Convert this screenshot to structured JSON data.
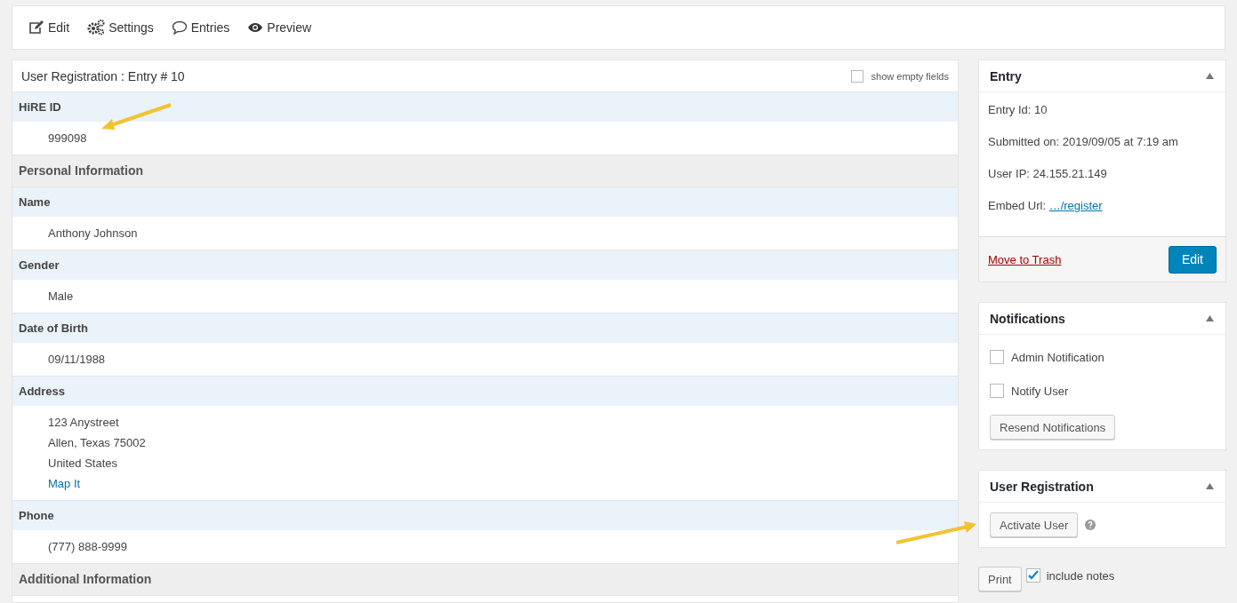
{
  "toolbar": [
    {
      "label": "Edit"
    },
    {
      "label": "Settings"
    },
    {
      "label": "Entries"
    },
    {
      "label": "Preview"
    }
  ],
  "entry_panel": {
    "title": "User Registration : Entry # 10",
    "show_empty_fields": {
      "label": "show empty fields",
      "checked": false
    },
    "rows": [
      {
        "kind": "field",
        "label": "HiRE ID",
        "values": [
          "999098"
        ]
      },
      {
        "kind": "section",
        "label": "Personal Information"
      },
      {
        "kind": "field",
        "label": "Name",
        "values": [
          "Anthony Johnson"
        ]
      },
      {
        "kind": "field",
        "label": "Gender",
        "values": [
          "Male"
        ]
      },
      {
        "kind": "field",
        "label": "Date of Birth",
        "values": [
          "09/11/1988"
        ]
      },
      {
        "kind": "field",
        "label": "Address",
        "values": [
          "123 Anystreet",
          "Allen, Texas 75002",
          "United States"
        ],
        "link": "Map It"
      },
      {
        "kind": "field",
        "label": "Phone",
        "values": [
          "(777) 888-9999"
        ]
      },
      {
        "kind": "section",
        "label": "Additional Information"
      }
    ]
  },
  "entry_box": {
    "title": "Entry",
    "lines": [
      {
        "text": "Entry Id: 10"
      },
      {
        "text": "Submitted on: 2019/09/05 at 7:19 am"
      },
      {
        "text": "User IP: 24.155.21.149"
      },
      {
        "text": "Embed Url:",
        "link": "…/register"
      }
    ],
    "trash": "Move to Trash",
    "edit": "Edit"
  },
  "notifications_box": {
    "title": "Notifications",
    "options": [
      {
        "label": "Admin Notification",
        "checked": false
      },
      {
        "label": "Notify User",
        "checked": false
      }
    ],
    "button": "Resend Notifications"
  },
  "user_registration_box": {
    "title": "User Registration",
    "button": "Activate User"
  },
  "print": {
    "button": "Print",
    "include_notes": {
      "label": "include notes",
      "checked": true
    }
  }
}
